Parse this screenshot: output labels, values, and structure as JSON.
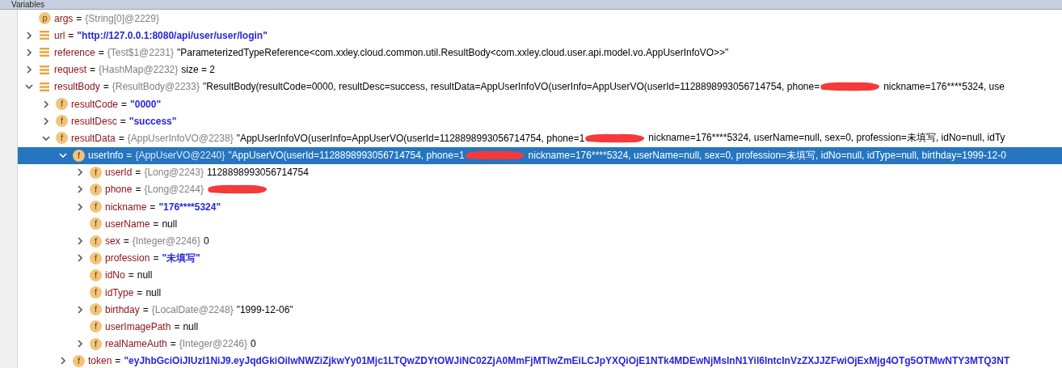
{
  "panel": {
    "title": "Variables"
  },
  "nodes": [
    {
      "kind": "param",
      "badge": "p",
      "name": "args",
      "eq": "=",
      "type": "{String[0]@2229}",
      "expandable": false,
      "selected": false
    },
    {
      "kind": "local",
      "name": "url",
      "eq": "=",
      "string_value": true,
      "value": [
        {
          "kind": "text",
          "text": "\"http://127.0.0.1:8080/api/user/user/login\""
        }
      ],
      "expandable": true,
      "expanded": false,
      "selected": false
    },
    {
      "kind": "local",
      "name": "reference",
      "eq": "=",
      "type": "{Test$1@2231}",
      "string_value": false,
      "value": [
        {
          "kind": "text",
          "text": "\"ParameterizedTypeReference<com.xxley.cloud.common.util.ResultBody<com.xxley.cloud.user.api.model.vo.AppUserInfoVO>>\""
        }
      ],
      "expandable": true,
      "expanded": false,
      "selected": false
    },
    {
      "kind": "local",
      "name": "request",
      "eq": "=",
      "type": "{HashMap@2232}",
      "string_value": false,
      "value": [
        {
          "kind": "text",
          "text": "size = 2"
        }
      ],
      "expandable": true,
      "expanded": false,
      "selected": false
    },
    {
      "kind": "local",
      "name": "resultBody",
      "eq": "=",
      "type": "{ResultBody@2233}",
      "string_value": false,
      "value": [
        {
          "kind": "text",
          "text": "\"ResultBody(resultCode=0000, resultDesc=success, resultData=AppUserInfoVO(userInfo=AppUserVO(userId=1128898993056714754, phone="
        },
        {
          "kind": "redaction"
        },
        {
          "kind": "text",
          "text": "nickname=176****5324, use"
        }
      ],
      "expandable": true,
      "expanded": true,
      "selected": false,
      "children": [
        {
          "kind": "field",
          "badge": "f",
          "name": "resultCode",
          "eq": "=",
          "string_value": true,
          "value": [
            {
              "kind": "text",
              "text": "\"0000\""
            }
          ],
          "expandable": true,
          "expanded": false,
          "selected": false
        },
        {
          "kind": "field",
          "badge": "f",
          "name": "resultDesc",
          "eq": "=",
          "string_value": true,
          "value": [
            {
              "kind": "text",
              "text": "\"success\""
            }
          ],
          "expandable": true,
          "expanded": false,
          "selected": false
        },
        {
          "kind": "field",
          "badge": "f",
          "name": "resultData",
          "eq": "=",
          "type": "{AppUserInfoVO@2238}",
          "string_value": false,
          "value": [
            {
              "kind": "text",
              "text": "\"AppUserInfoVO(userInfo=AppUserVO(userId=1128898993056714754, phone=1"
            },
            {
              "kind": "redaction"
            },
            {
              "kind": "text",
              "text": "nickname=176****5324, userName=null, sex=0, profession=未填写, idNo=null, idTy"
            }
          ],
          "expandable": true,
          "expanded": true,
          "selected": false,
          "children": [
            {
              "kind": "field",
              "badge": "f",
              "name": "userInfo",
              "eq": "=",
              "type": "{AppUserVO@2240}",
              "string_value": false,
              "value": [
                {
                  "kind": "text",
                  "text": "\"AppUserVO(userId=1128898993056714754, phone=1"
                },
                {
                  "kind": "redaction"
                },
                {
                  "kind": "text",
                  "text": "nickname=176****5324, userName=null, sex=0, profession=未填写, idNo=null, idType=null, birthday=1999-12-0"
                }
              ],
              "expandable": true,
              "expanded": true,
              "selected": true,
              "children": [
                {
                  "kind": "field",
                  "badge": "f",
                  "name": "userId",
                  "eq": "=",
                  "type": "{Long@2243}",
                  "string_value": false,
                  "value": [
                    {
                      "kind": "text",
                      "text": "1128898993056714754"
                    }
                  ],
                  "expandable": true,
                  "expanded": false,
                  "selected": false
                },
                {
                  "kind": "field",
                  "badge": "f",
                  "name": "phone",
                  "eq": "=",
                  "type": "{Long@2244}",
                  "value": [
                    {
                      "kind": "redaction"
                    }
                  ],
                  "expandable": true,
                  "expanded": false,
                  "selected": false
                },
                {
                  "kind": "field",
                  "badge": "f",
                  "name": "nickname",
                  "eq": "=",
                  "string_value": true,
                  "value": [
                    {
                      "kind": "text",
                      "text": "\"176****5324\""
                    }
                  ],
                  "expandable": true,
                  "expanded": false,
                  "selected": false
                },
                {
                  "kind": "field",
                  "badge": "f",
                  "name": "userName",
                  "eq": "=",
                  "string_value": false,
                  "value": [
                    {
                      "kind": "text",
                      "text": "null"
                    }
                  ],
                  "expandable": false,
                  "selected": false
                },
                {
                  "kind": "field",
                  "badge": "f",
                  "name": "sex",
                  "eq": "=",
                  "type": "{Integer@2246}",
                  "string_value": false,
                  "value": [
                    {
                      "kind": "text",
                      "text": "0"
                    }
                  ],
                  "expandable": true,
                  "expanded": false,
                  "selected": false
                },
                {
                  "kind": "field",
                  "badge": "f",
                  "name": "profession",
                  "eq": "=",
                  "string_value": true,
                  "value": [
                    {
                      "kind": "text",
                      "text": "\"未填写\""
                    }
                  ],
                  "expandable": true,
                  "expanded": false,
                  "selected": false
                },
                {
                  "kind": "field",
                  "badge": "f",
                  "name": "idNo",
                  "eq": "=",
                  "string_value": false,
                  "value": [
                    {
                      "kind": "text",
                      "text": "null"
                    }
                  ],
                  "expandable": false,
                  "selected": false
                },
                {
                  "kind": "field",
                  "badge": "f",
                  "name": "idType",
                  "eq": "=",
                  "string_value": false,
                  "value": [
                    {
                      "kind": "text",
                      "text": "null"
                    }
                  ],
                  "expandable": false,
                  "selected": false
                },
                {
                  "kind": "field",
                  "badge": "f",
                  "name": "birthday",
                  "eq": "=",
                  "type": "{LocalDate@2248}",
                  "string_value": false,
                  "value": [
                    {
                      "kind": "text",
                      "text": "\"1999-12-06\""
                    }
                  ],
                  "expandable": true,
                  "expanded": false,
                  "selected": false
                },
                {
                  "kind": "field",
                  "badge": "f",
                  "name": "userImagePath",
                  "eq": "=",
                  "string_value": false,
                  "value": [
                    {
                      "kind": "text",
                      "text": "null"
                    }
                  ],
                  "expandable": false,
                  "selected": false
                },
                {
                  "kind": "field",
                  "badge": "f",
                  "name": "realNameAuth",
                  "eq": "=",
                  "type": "{Integer@2246}",
                  "string_value": false,
                  "value": [
                    {
                      "kind": "text",
                      "text": "0"
                    }
                  ],
                  "expandable": true,
                  "expanded": false,
                  "selected": false
                }
              ]
            },
            {
              "kind": "field",
              "badge": "f",
              "name": "token",
              "eq": "=",
              "string_value": true,
              "value": [
                {
                  "kind": "text",
                  "text": "\"eyJhbGciOiJIUzI1NiJ9.eyJqdGkiOiIwNWZiZjkwYy01Mjc1LTQwZDYtOWJiNC02ZjA0MmFjMTIwZmEiLCJpYXQiOjE1NTk4MDEwNjMsInN1YiI6IntcInVzZXJJZFwiOjExMjg4OTg5OTMwNTY3MTQ3NT"
                }
              ],
              "expandable": true,
              "expanded": false,
              "selected": false
            }
          ]
        }
      ]
    }
  ]
}
